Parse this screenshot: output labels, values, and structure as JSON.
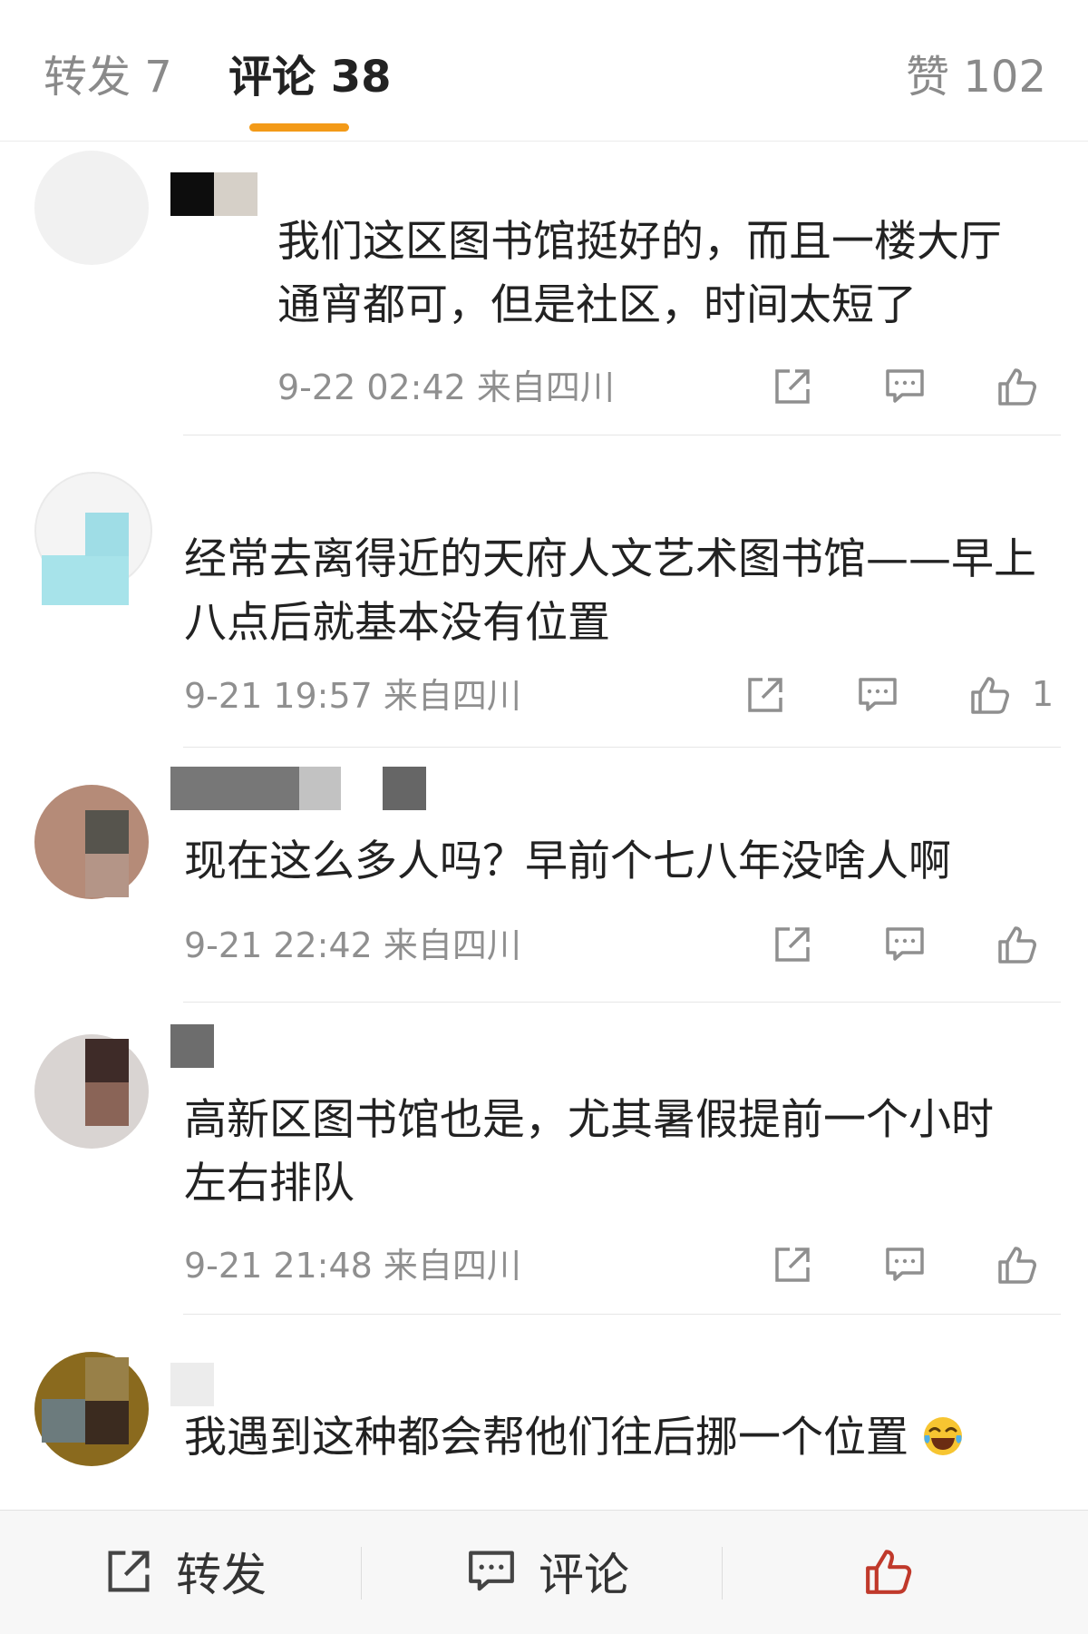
{
  "tabs": {
    "repost": "转发 7",
    "comment": "评论 38",
    "like": "赞 102"
  },
  "comments": [
    {
      "text_lines": [
        "我们这区图书馆挺好的，而且一楼大厅",
        "通宵都可，但是社区，时间太短了"
      ],
      "meta": "9-22 02:42  来自四川",
      "likes": ""
    },
    {
      "text_lines": [
        "经常去离得近的天府人文艺术图书馆——早上",
        "八点后就基本没有位置"
      ],
      "meta": "9-21 19:57  来自四川",
      "likes": "1"
    },
    {
      "text_lines": [
        "现在这么多人吗？早前个七八年没啥人啊"
      ],
      "meta": "9-21 22:42  来自四川",
      "likes": ""
    },
    {
      "text_lines": [
        "高新区图书馆也是，尤其暑假提前一个小时",
        "左右排队"
      ],
      "meta": "9-21 21:48  来自四川",
      "likes": ""
    },
    {
      "text_lines": [
        "我遇到这种都会帮他们往后挪一个位置"
      ],
      "meta": "",
      "likes": ""
    }
  ],
  "icons": {
    "share": "share-icon",
    "reply": "comment-bubble-icon",
    "like": "thumbs-up-icon",
    "emoji": "laughing-crying-emoji"
  },
  "bottom_bar": {
    "repost_label": "转发",
    "comment_label": "评论"
  },
  "colors": {
    "accent": "#f39a18",
    "text": "#222222",
    "muted": "#8f8f8f"
  }
}
